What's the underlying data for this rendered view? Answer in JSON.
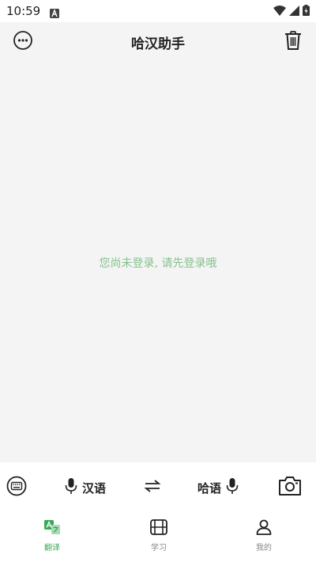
{
  "status_bar": {
    "time": "10:59"
  },
  "header": {
    "title": "哈汉助手"
  },
  "main": {
    "login_message": "您尚未登录, 请先登录哦"
  },
  "input_bar": {
    "source_lang": "汉语",
    "target_lang": "哈语"
  },
  "tabs": [
    {
      "label": "翻译",
      "icon": "translate-icon",
      "active": true
    },
    {
      "label": "学习",
      "icon": "learn-icon",
      "active": false
    },
    {
      "label": "我的",
      "icon": "person-icon",
      "active": false
    }
  ],
  "colors": {
    "accent": "#3aa858",
    "login_text": "#86c28e",
    "background": "#f4f4f4"
  }
}
